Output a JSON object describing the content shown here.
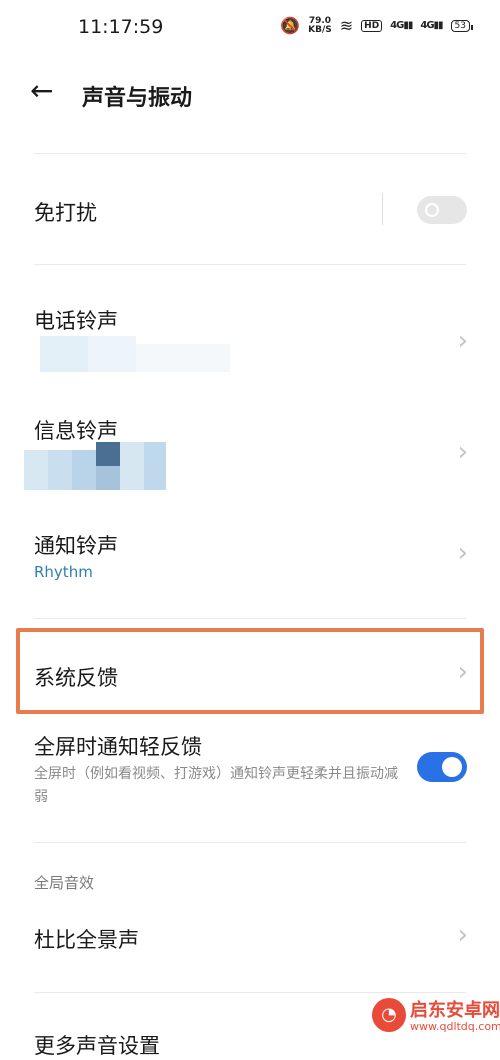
{
  "status": {
    "time": "11:17:59",
    "speed_value": "79.0",
    "speed_unit": "KB/S",
    "hd": "HD",
    "sim1": "4G",
    "sim2": "4G",
    "battery": "53"
  },
  "header": {
    "back_icon": "arrow-left-icon",
    "title": "声音与振动"
  },
  "rows": {
    "dnd": {
      "title": "免打扰",
      "toggle_on": false
    },
    "phone_ringtone": {
      "title": "电话铃声"
    },
    "message_ringtone": {
      "title": "信息铃声"
    },
    "notification_ringtone": {
      "title": "通知铃声",
      "value": "Rhythm"
    },
    "system_feedback": {
      "title": "系统反馈"
    },
    "fullscreen_feedback": {
      "title": "全屏时通知轻反馈",
      "description": "全屏时（例如看视频、打游戏）通知铃声更轻柔并且振动减弱",
      "toggle_on": true
    },
    "dolby": {
      "title": "杜比全景声"
    },
    "cutoff": {
      "title": "更多声音设置"
    }
  },
  "sections": {
    "global_sound": "全局音效"
  },
  "watermark": {
    "name": "启东安卓网",
    "url": "www.qdltdq.com"
  },
  "colors": {
    "accent_blue": "#2b71e6",
    "highlight": "#e77c4d",
    "subtitle_blue": "#2f7fb6"
  }
}
